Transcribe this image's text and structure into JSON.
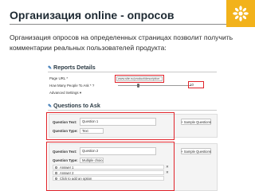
{
  "slide": {
    "title": "Организация online - опросов",
    "intro": "Организация опросов на определенных страницах позволит получить комментарии реальных пользователей продукта:",
    "accent_color": "#f2b21b",
    "highlight_color": "#e0232a"
  },
  "report_details": {
    "heading": "Reports Details",
    "page_url_label": "Page URL *",
    "page_url_value": "www.site.ru/product/description",
    "people_label": "How Many People To Ask * ?",
    "people_value": "10",
    "advanced_label": "Advanced Settings ▾"
  },
  "questions": {
    "heading": "Questions to Ask",
    "items": [
      {
        "text_label": "Question Text:",
        "text_value": "Question 1",
        "type_label": "Question Type:",
        "type_value": "Text",
        "sample_button": "+ Sample Questions"
      },
      {
        "text_label": "Question Text:",
        "text_value": "Question 2",
        "type_label": "Question Type:",
        "type_value": "Multiple choice",
        "sample_button": "+ Sample Questions",
        "answers": [
          "Answer 1",
          "Answer 2"
        ],
        "add_option": "Click to add an option",
        "remove_symbol": "✕"
      }
    ]
  }
}
